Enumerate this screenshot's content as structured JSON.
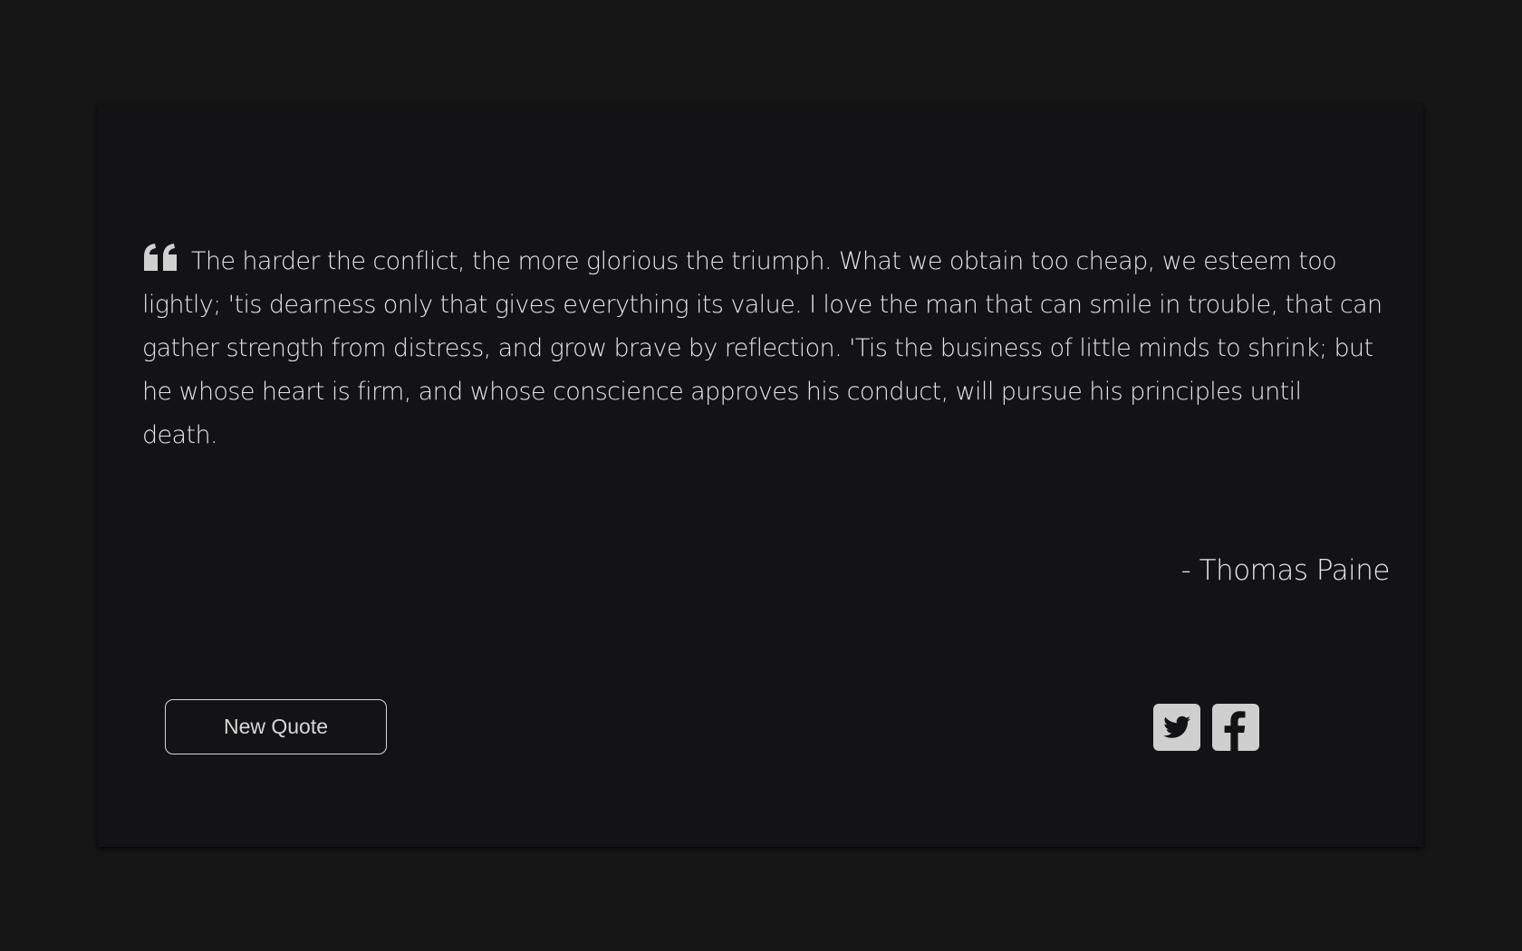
{
  "quote": {
    "text": "The harder the conflict, the more glorious the triumph. What we obtain too cheap, we esteem too lightly; 'tis dearness only that gives everything its value. I love the man that can smile in trouble, that can gather strength from distress, and grow brave by reflection. 'Tis the business of little minds to shrink; but he whose heart is firm, and whose conscience approves his conduct, will pursue his principles until death.",
    "author": "- Thomas Paine",
    "icon": "quote-left-icon"
  },
  "actions": {
    "new_quote_label": "New Quote"
  },
  "social": {
    "twitter_icon": "twitter-square-icon",
    "facebook_icon": "facebook-square-icon"
  },
  "colors": {
    "page_background": "#161616",
    "card_background": "#131315",
    "text": "#e6e6e6",
    "icon": "#cfcfcf"
  }
}
